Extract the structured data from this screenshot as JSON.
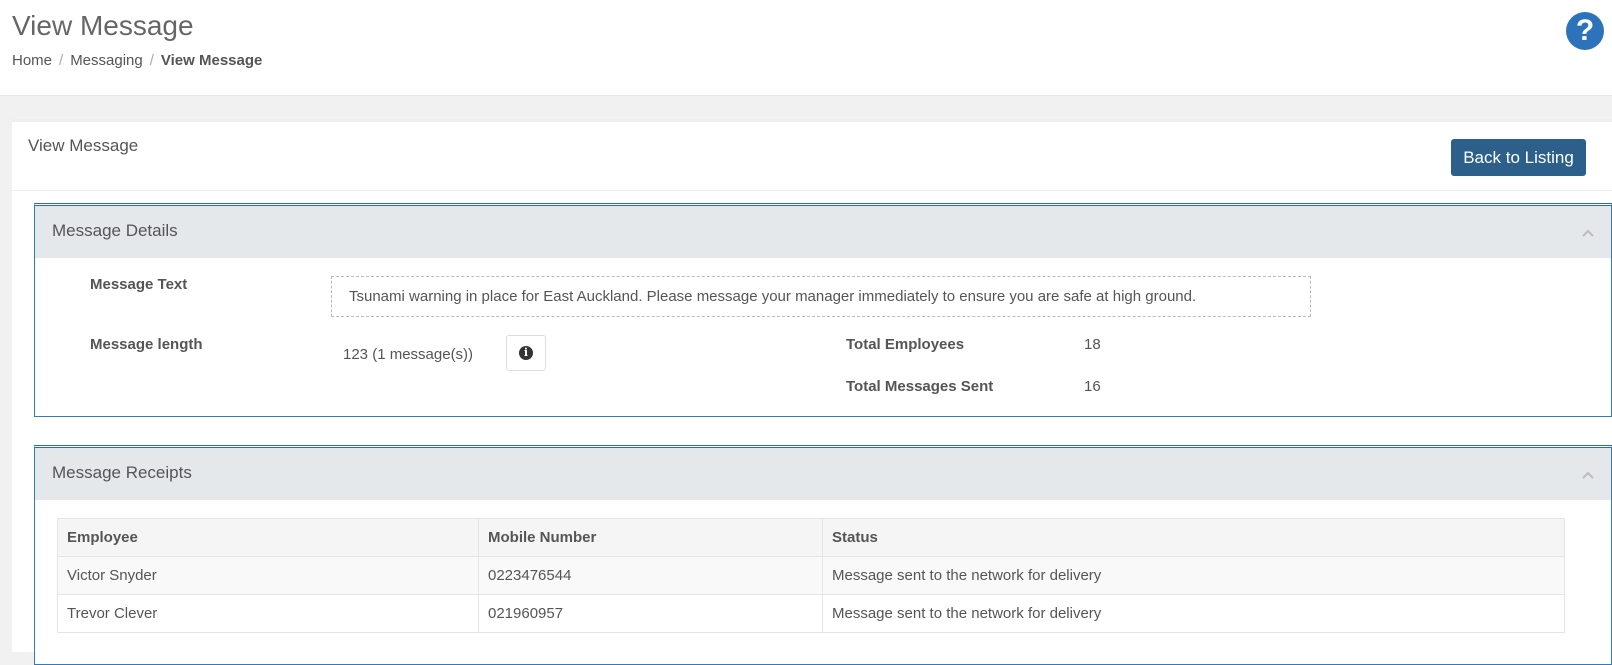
{
  "header": {
    "title": "View Message",
    "help_icon_label": "?",
    "breadcrumb": [
      "Home",
      "Messaging",
      "View Message"
    ]
  },
  "portlet": {
    "caption": "View Message",
    "back_label": "Back to Listing"
  },
  "details": {
    "title": "Message Details",
    "message_text_label": "Message Text",
    "message_text": "Tsunami warning in place for East Auckland. Please message your manager immediately to ensure you are safe at high ground.",
    "length_label": "Message length",
    "length_value": "123 (1 message(s))",
    "total_employees_label": "Total Employees",
    "total_employees": "18",
    "total_sent_label": "Total Messages Sent",
    "total_sent": "16"
  },
  "receipts": {
    "title": "Message Receipts",
    "columns": [
      "Employee",
      "Mobile Number",
      "Status"
    ],
    "rows": [
      [
        "Victor Snyder",
        "0223476544",
        "Message sent to the network for delivery"
      ],
      [
        "Trevor Clever",
        "021960957",
        "Message sent to the network for delivery"
      ]
    ]
  },
  "colors": {
    "accent": "#2d5f8b",
    "help": "#2d73ba",
    "panel_border": "#337ab7"
  }
}
